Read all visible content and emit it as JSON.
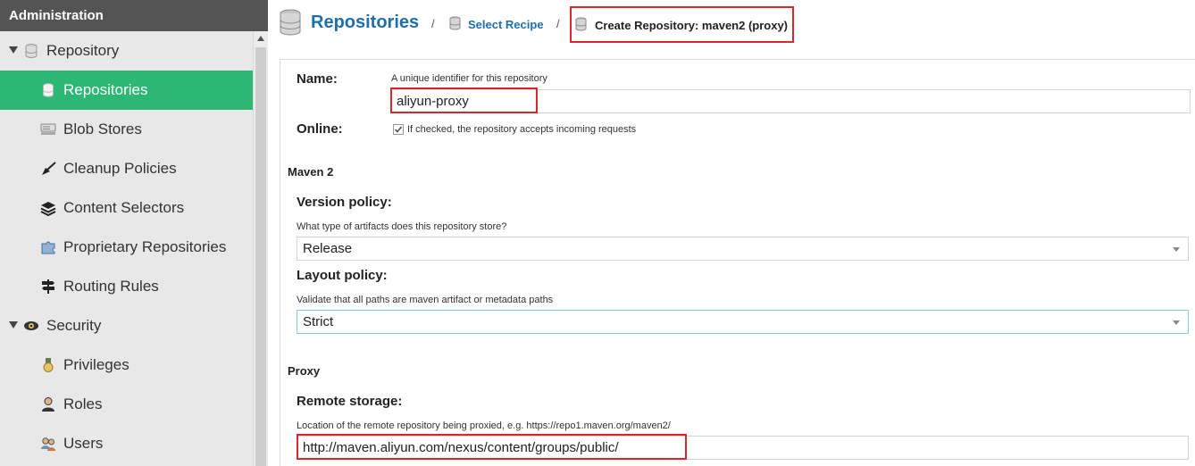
{
  "sidebar": {
    "header": "Administration",
    "items": [
      {
        "label": "Repository",
        "icon": "database-icon",
        "level": "parent",
        "expanded": true
      },
      {
        "label": "Repositories",
        "icon": "database-icon",
        "level": "child",
        "selected": true
      },
      {
        "label": "Blob Stores",
        "icon": "server-icon",
        "level": "child"
      },
      {
        "label": "Cleanup Policies",
        "icon": "broom-icon",
        "level": "child"
      },
      {
        "label": "Content Selectors",
        "icon": "layers-icon",
        "level": "child"
      },
      {
        "label": "Proprietary Repositories",
        "icon": "puzzle-icon",
        "level": "child"
      },
      {
        "label": "Routing Rules",
        "icon": "signpost-icon",
        "level": "child"
      },
      {
        "label": "Security",
        "icon": "eye-icon",
        "level": "parent",
        "expanded": true
      },
      {
        "label": "Privileges",
        "icon": "medal-icon",
        "level": "child"
      },
      {
        "label": "Roles",
        "icon": "user-icon",
        "level": "child"
      },
      {
        "label": "Users",
        "icon": "users-icon",
        "level": "child"
      }
    ]
  },
  "breadcrumb": {
    "root": "Repositories",
    "separator": "/",
    "step": "Select Recipe",
    "current": "Create Repository: maven2 (proxy)"
  },
  "form": {
    "name_label": "Name:",
    "name_help": "A unique identifier for this repository",
    "name_value": "aliyun-proxy",
    "online_label": "Online:",
    "online_checked": true,
    "online_help": "If checked, the repository accepts incoming requests",
    "maven_section": "Maven 2",
    "version_label": "Version policy:",
    "version_help": "What type of artifacts does this repository store?",
    "version_value": "Release",
    "layout_label": "Layout policy:",
    "layout_help": "Validate that all paths are maven artifact or metadata paths",
    "layout_value": "Strict",
    "proxy_section": "Proxy",
    "remote_label": "Remote storage:",
    "remote_help": "Location of the remote repository being proxied, e.g. https://repo1.maven.org/maven2/",
    "remote_value": "http://maven.aliyun.com/nexus/content/groups/public/"
  },
  "colors": {
    "accent": "#2db774",
    "link": "#1f6eae",
    "highlight": "#d9272e",
    "header": "#545454"
  }
}
